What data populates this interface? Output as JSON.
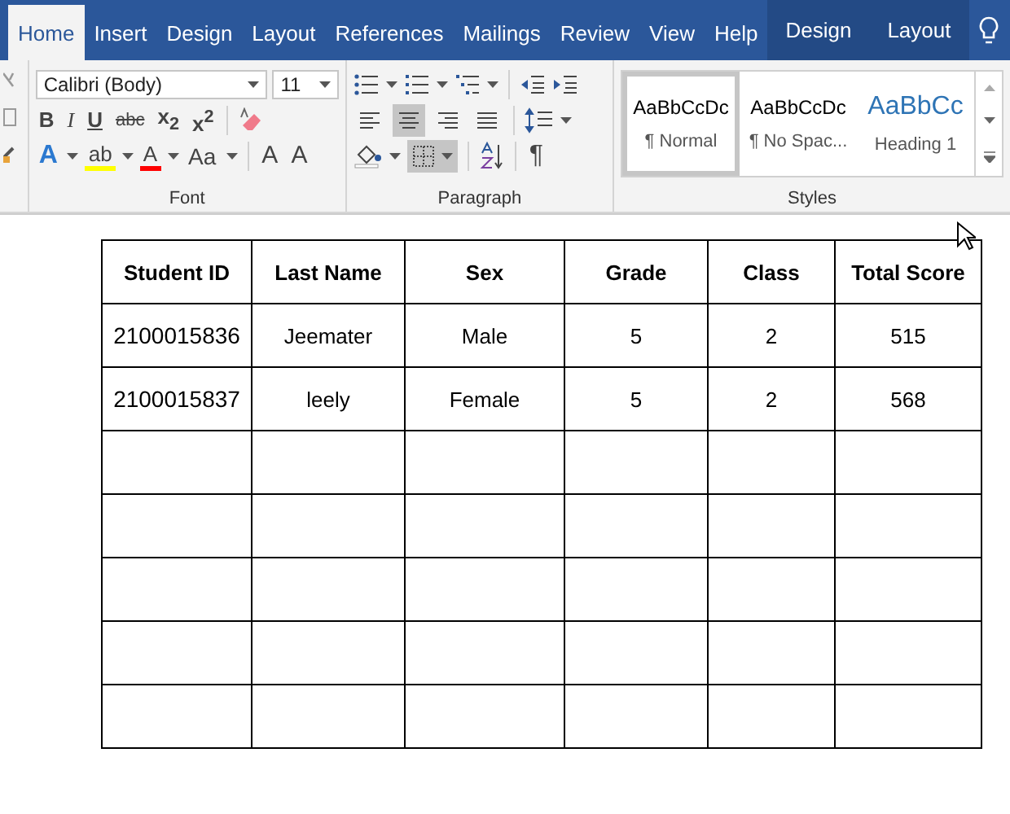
{
  "tabs": [
    {
      "label": "Home",
      "selected": true,
      "contextual": false
    },
    {
      "label": "Insert",
      "selected": false,
      "contextual": false
    },
    {
      "label": "Design",
      "selected": false,
      "contextual": false
    },
    {
      "label": "Layout",
      "selected": false,
      "contextual": false
    },
    {
      "label": "References",
      "selected": false,
      "contextual": false
    },
    {
      "label": "Mailings",
      "selected": false,
      "contextual": false
    },
    {
      "label": "Review",
      "selected": false,
      "contextual": false
    },
    {
      "label": "View",
      "selected": false,
      "contextual": false
    },
    {
      "label": "Help",
      "selected": false,
      "contextual": false
    },
    {
      "label": "Design",
      "selected": false,
      "contextual": true
    },
    {
      "label": "Layout",
      "selected": false,
      "contextual": true
    }
  ],
  "font": {
    "label": "Font",
    "font_name": "Calibri (Body)",
    "font_size": "11",
    "format_buttons": [
      {
        "text": "B",
        "kind": "bold"
      },
      {
        "text": "I",
        "kind": "italic"
      },
      {
        "text": "U",
        "kind": "underline"
      },
      {
        "text": "abc",
        "kind": "strike"
      },
      {
        "text": "x$_{2}$",
        "kind": "sub"
      },
      {
        "text": "x$^{2}$",
        "kind": "sup"
      }
    ],
    "effects_text": "A",
    "highlight_text": "ab",
    "font_color_text": "A",
    "case_text": "Aa",
    "grow_text": "A",
    "shrink_text": "A"
  },
  "paragraph": {
    "label": "Paragraph",
    "alignments": [
      {
        "kind": "left",
        "selected": false
      },
      {
        "kind": "center",
        "selected": true
      },
      {
        "kind": "right",
        "selected": false
      },
      {
        "kind": "justify",
        "selected": false
      }
    ],
    "borders_selected": true,
    "marks_text": "¶"
  },
  "styles": {
    "label": "Styles",
    "items": [
      {
        "preview": "AaBbCcDc",
        "name": "¶ Normal",
        "selected": true,
        "kind": "normal"
      },
      {
        "preview": "AaBbCcDc",
        "name": "¶ No Spac...",
        "selected": false,
        "kind": "normal"
      },
      {
        "preview": "AaBbCc",
        "name": "Heading 1",
        "selected": false,
        "kind": "heading"
      }
    ]
  },
  "table": {
    "columns": [
      "Student ID",
      "Last Name",
      "Sex",
      "Grade",
      "Class",
      "Total Score"
    ],
    "rows": [
      {
        "cells": [
          "2100015836",
          "Jeemater",
          "Male",
          "5",
          "2",
          "515"
        ]
      },
      {
        "cells": [
          "2100015837",
          "leely",
          "Female",
          "5",
          "2",
          "568"
        ]
      },
      {
        "empty": true
      },
      {
        "empty": true
      },
      {
        "empty": true
      },
      {
        "empty": true
      },
      {
        "empty": true
      }
    ]
  }
}
